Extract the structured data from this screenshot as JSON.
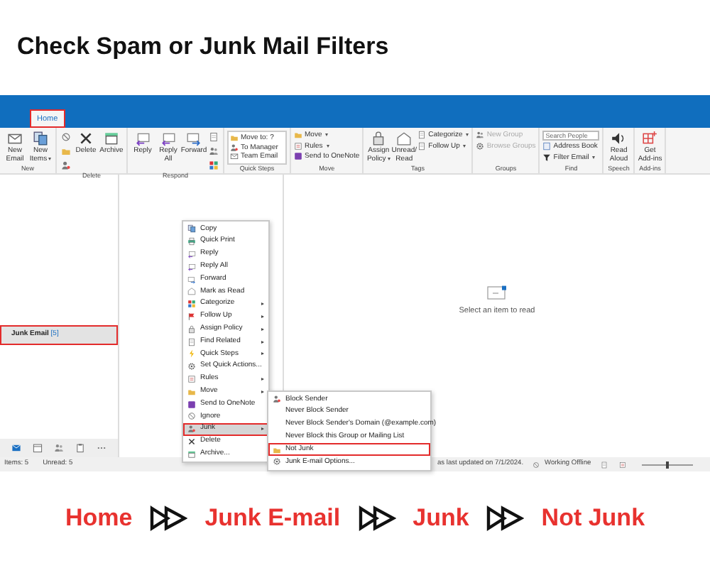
{
  "heading": "Check Spam or Junk Mail Filters",
  "tabs": [
    {
      "label": "Home",
      "selected": true,
      "highlighted": true
    }
  ],
  "ribbon": [
    {
      "label": "New",
      "items": [
        {
          "kind": "large",
          "label": "New Email",
          "dropdown": false
        },
        {
          "kind": "large",
          "label": "New Items",
          "dropdown": true
        }
      ]
    },
    {
      "label": "Delete",
      "items": [
        {
          "kind": "icon-column"
        },
        {
          "kind": "large",
          "label": "Delete",
          "dropdown": false
        },
        {
          "kind": "large",
          "label": "Archive",
          "dropdown": false
        }
      ]
    },
    {
      "label": "Respond",
      "items": [
        {
          "kind": "large",
          "label": "Reply",
          "dropdown": false
        },
        {
          "kind": "large",
          "label": "Reply All",
          "dropdown": false
        },
        {
          "kind": "large",
          "label": "Forward",
          "dropdown": false
        },
        {
          "kind": "icon-column"
        }
      ]
    },
    {
      "label": "Quick Steps",
      "items": [
        {
          "kind": "list",
          "entries": [
            "Move to: ?",
            "To Manager",
            "Team Email"
          ]
        }
      ]
    },
    {
      "label": "Move",
      "items": [
        {
          "kind": "small-column",
          "entries": [
            {
              "kind": "command",
              "label": "Move",
              "dropdown": true,
              "disabled": false
            },
            {
              "kind": "command",
              "label": "Rules",
              "dropdown": true,
              "disabled": false
            },
            {
              "kind": "command",
              "label": "Send to OneNote",
              "dropdown": false,
              "disabled": false
            }
          ]
        }
      ]
    },
    {
      "label": "Tags",
      "items": [
        {
          "kind": "large",
          "label": "Assign Policy",
          "dropdown": true
        },
        {
          "kind": "large",
          "label": "Unread/ Read",
          "dropdown": false
        },
        {
          "kind": "small-column",
          "entries": [
            {
              "kind": "command",
              "label": "Categorize",
              "dropdown": true,
              "disabled": false
            },
            {
              "kind": "command",
              "label": "Follow Up",
              "dropdown": true,
              "disabled": false
            }
          ]
        }
      ]
    },
    {
      "label": "Groups",
      "items": [
        {
          "kind": "small-column",
          "entries": [
            {
              "kind": "command",
              "label": "New Group",
              "dropdown": false,
              "disabled": true
            },
            {
              "kind": "command",
              "label": "Browse Groups",
              "dropdown": false,
              "disabled": true
            }
          ]
        }
      ]
    },
    {
      "label": "Find",
      "items": [
        {
          "kind": "small-column",
          "entries": [
            {
              "kind": "field",
              "placeholder": "Search People"
            },
            {
              "kind": "command",
              "label": "Address Book",
              "dropdown": false,
              "disabled": false
            },
            {
              "kind": "command",
              "label": "Filter Email",
              "dropdown": true,
              "disabled": false
            }
          ]
        }
      ]
    },
    {
      "label": "Speech",
      "items": [
        {
          "kind": "large",
          "label": "Read Aloud",
          "dropdown": false
        }
      ]
    },
    {
      "label": "Add-ins",
      "items": [
        {
          "kind": "large",
          "label": "Get Add-ins",
          "dropdown": false
        }
      ]
    }
  ],
  "folders": [
    {
      "name": "Junk Email",
      "count": "[5]",
      "selected": true,
      "highlighted": true
    }
  ],
  "nav": [
    {
      "selected": true
    },
    {
      "selected": false
    },
    {
      "selected": false
    },
    {
      "selected": false
    },
    {
      "selected": false
    }
  ],
  "reading_pane": {
    "message": "Select an item to read"
  },
  "context_menu": [
    {
      "label": "Copy",
      "submenu": false,
      "selected": false,
      "highlighted": false
    },
    {
      "label": "Quick Print",
      "submenu": false,
      "selected": false,
      "highlighted": false
    },
    {
      "label": "Reply",
      "submenu": false,
      "selected": false,
      "highlighted": false
    },
    {
      "label": "Reply All",
      "submenu": false,
      "selected": false,
      "highlighted": false
    },
    {
      "label": "Forward",
      "submenu": false,
      "selected": false,
      "highlighted": false
    },
    {
      "label": "Mark as Read",
      "submenu": false,
      "selected": false,
      "highlighted": false
    },
    {
      "label": "Categorize",
      "submenu": true,
      "selected": false,
      "highlighted": false
    },
    {
      "label": "Follow Up",
      "submenu": true,
      "selected": false,
      "highlighted": false
    },
    {
      "label": "Assign Policy",
      "submenu": true,
      "selected": false,
      "highlighted": false
    },
    {
      "label": "Find Related",
      "submenu": true,
      "selected": false,
      "highlighted": false
    },
    {
      "label": "Quick Steps",
      "submenu": true,
      "selected": false,
      "highlighted": false
    },
    {
      "label": "Set Quick Actions...",
      "submenu": false,
      "selected": false,
      "highlighted": false
    },
    {
      "label": "Rules",
      "submenu": true,
      "selected": false,
      "highlighted": false
    },
    {
      "label": "Move",
      "submenu": true,
      "selected": false,
      "highlighted": false
    },
    {
      "label": "Send to OneNote",
      "submenu": false,
      "selected": false,
      "highlighted": false
    },
    {
      "label": "Ignore",
      "submenu": false,
      "selected": false,
      "highlighted": false
    },
    {
      "label": "Junk",
      "submenu": true,
      "selected": true,
      "highlighted": true
    },
    {
      "label": "Delete",
      "submenu": false,
      "selected": false,
      "highlighted": false
    },
    {
      "label": "Archive...",
      "submenu": false,
      "selected": false,
      "highlighted": false
    }
  ],
  "junk_submenu": [
    {
      "label": "Block Sender",
      "highlighted": false
    },
    {
      "label": "Never Block Sender",
      "highlighted": false
    },
    {
      "label": "Never Block Sender's Domain (@example.com)",
      "highlighted": false
    },
    {
      "label": "Never Block this Group or Mailing List",
      "highlighted": false
    },
    {
      "label": "Not Junk",
      "highlighted": true
    },
    {
      "label": "Junk E-mail Options...",
      "highlighted": false
    }
  ],
  "status_bar": {
    "items": "Items: 5",
    "unread": "Unread: 5",
    "sync": "as last updated on 7/1/2024.",
    "connection": "Working Offline",
    "zoom": {
      "level": 0.5
    }
  },
  "breadcrumb": [
    "Home",
    "Junk E-mail",
    "Junk",
    "Not Junk"
  ]
}
